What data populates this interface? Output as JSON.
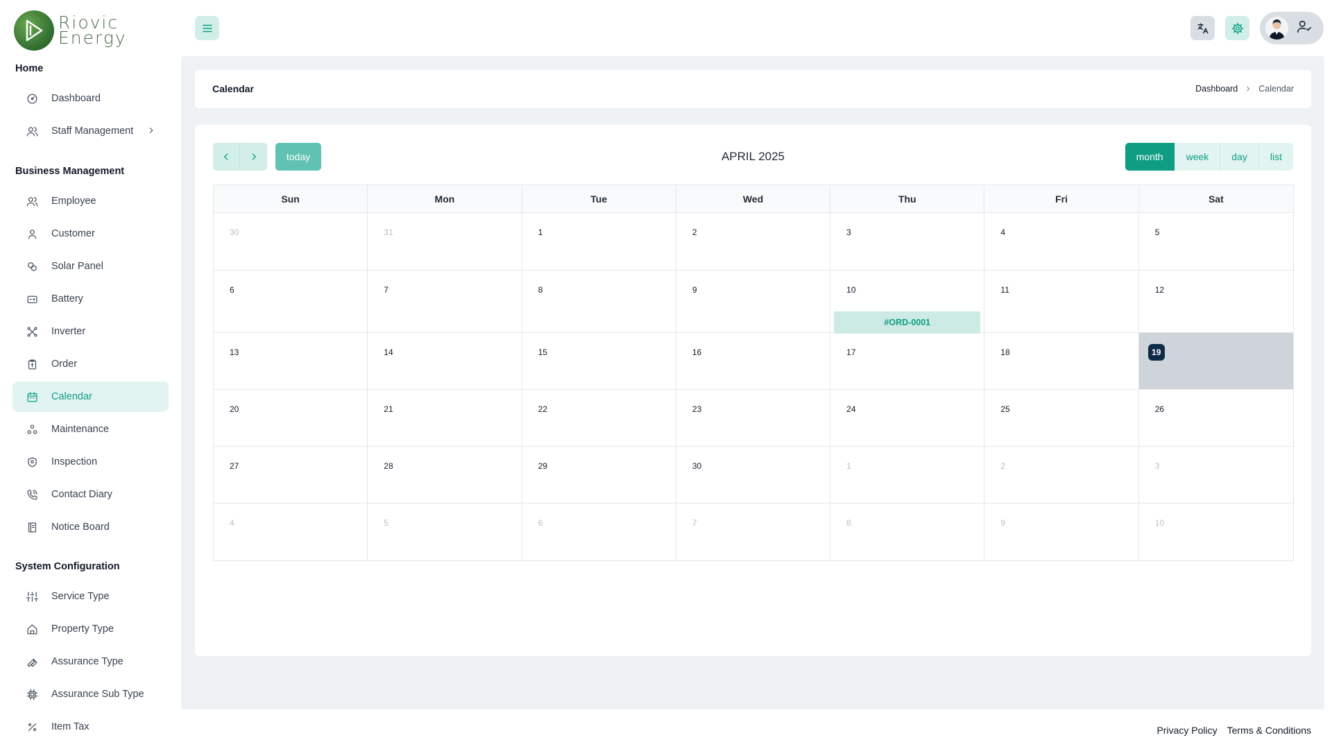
{
  "brand": {
    "line1": "Riovic",
    "line2": "Energy"
  },
  "sidebar": {
    "sections": [
      {
        "title": "Home"
      },
      {
        "title": "Business Management"
      },
      {
        "title": "System Configuration"
      }
    ],
    "items": [
      {
        "label": "Dashboard",
        "icon": "dashboard-icon"
      },
      {
        "label": "Staff Management",
        "icon": "users-icon"
      },
      {
        "label": "Employee",
        "icon": "users-icon"
      },
      {
        "label": "Customer",
        "icon": "user-icon"
      },
      {
        "label": "Solar Panel",
        "icon": "solar-panel-icon"
      },
      {
        "label": "Battery",
        "icon": "battery-icon"
      },
      {
        "label": "Inverter",
        "icon": "inverter-icon"
      },
      {
        "label": "Order",
        "icon": "order-icon"
      },
      {
        "label": "Calendar",
        "icon": "calendar-icon",
        "active": true
      },
      {
        "label": "Maintenance",
        "icon": "maintenance-icon"
      },
      {
        "label": "Inspection",
        "icon": "shield-icon"
      },
      {
        "label": "Contact Diary",
        "icon": "phone-icon"
      },
      {
        "label": "Notice Board",
        "icon": "notice-icon"
      },
      {
        "label": "Service Type",
        "icon": "sliders-icon"
      },
      {
        "label": "Property Type",
        "icon": "home-icon"
      },
      {
        "label": "Assurance Type",
        "icon": "wrench-icon"
      },
      {
        "label": "Assurance Sub Type",
        "icon": "chip-icon"
      },
      {
        "label": "Item Tax",
        "icon": "percent-icon"
      }
    ]
  },
  "header": {
    "page_title": "Calendar",
    "breadcrumb": {
      "parent": "Dashboard",
      "current": "Calendar"
    }
  },
  "calendar": {
    "title": "APRIL 2025",
    "today_label": "today",
    "views": [
      "month",
      "week",
      "day",
      "list"
    ],
    "active_view": "month",
    "weekdays": [
      "Sun",
      "Mon",
      "Tue",
      "Wed",
      "Thu",
      "Fri",
      "Sat"
    ],
    "weeks": [
      [
        {
          "d": "30",
          "other": true
        },
        {
          "d": "31",
          "other": true
        },
        {
          "d": "1"
        },
        {
          "d": "2"
        },
        {
          "d": "3"
        },
        {
          "d": "4"
        },
        {
          "d": "5"
        }
      ],
      [
        {
          "d": "6"
        },
        {
          "d": "7"
        },
        {
          "d": "8"
        },
        {
          "d": "9"
        },
        {
          "d": "10",
          "event": "#ORD-0001"
        },
        {
          "d": "11"
        },
        {
          "d": "12"
        }
      ],
      [
        {
          "d": "13"
        },
        {
          "d": "14"
        },
        {
          "d": "15"
        },
        {
          "d": "16"
        },
        {
          "d": "17"
        },
        {
          "d": "18"
        },
        {
          "d": "19",
          "today": true
        }
      ],
      [
        {
          "d": "20"
        },
        {
          "d": "21"
        },
        {
          "d": "22"
        },
        {
          "d": "23"
        },
        {
          "d": "24"
        },
        {
          "d": "25"
        },
        {
          "d": "26"
        }
      ],
      [
        {
          "d": "27"
        },
        {
          "d": "28"
        },
        {
          "d": "29"
        },
        {
          "d": "30"
        },
        {
          "d": "1",
          "other": true
        },
        {
          "d": "2",
          "other": true
        },
        {
          "d": "3",
          "other": true
        }
      ],
      [
        {
          "d": "4",
          "other": true
        },
        {
          "d": "5",
          "other": true
        },
        {
          "d": "6",
          "other": true
        },
        {
          "d": "7",
          "other": true
        },
        {
          "d": "8",
          "other": true
        },
        {
          "d": "9",
          "other": true
        },
        {
          "d": "10",
          "other": true
        }
      ]
    ]
  },
  "footer": {
    "privacy": "Privacy Policy",
    "terms": "Terms & Conditions"
  },
  "colors": {
    "accent": "#0f9d84",
    "accent_light": "#e2f4f1",
    "today_bg": "#cfd4da",
    "today_badge": "#0f2b45"
  }
}
